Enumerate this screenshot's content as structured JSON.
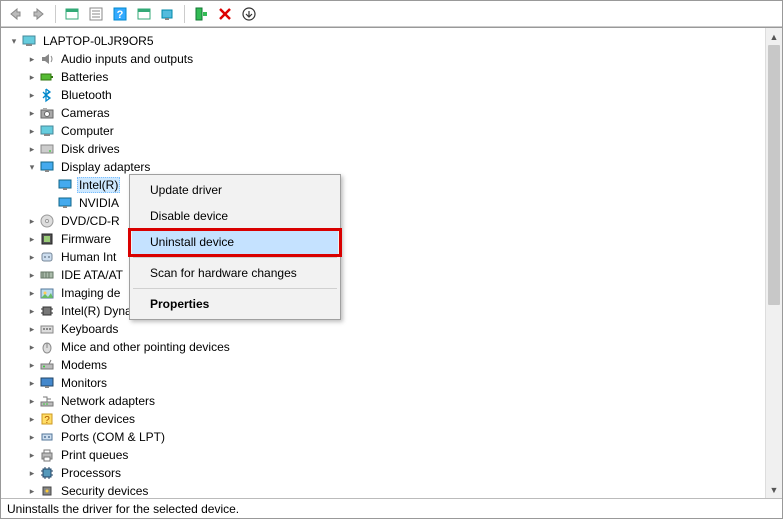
{
  "toolbar": {
    "icons": [
      "back",
      "forward",
      "sep",
      "show-hidden",
      "properties",
      "help",
      "update",
      "monitor",
      "sep",
      "add-legacy",
      "remove",
      "down"
    ]
  },
  "tree": {
    "root": {
      "label": "LAPTOP-0LJR9OR5",
      "expanded": true,
      "icon": "computer"
    },
    "items": [
      {
        "label": "Audio inputs and outputs",
        "icon": "audio",
        "expanded": false
      },
      {
        "label": "Batteries",
        "icon": "battery",
        "expanded": false
      },
      {
        "label": "Bluetooth",
        "icon": "bluetooth",
        "expanded": false
      },
      {
        "label": "Cameras",
        "icon": "camera",
        "expanded": false
      },
      {
        "label": "Computer",
        "icon": "computer",
        "expanded": false
      },
      {
        "label": "Disk drives",
        "icon": "disk",
        "expanded": false
      },
      {
        "label": "Display adapters",
        "icon": "display",
        "expanded": true,
        "children": [
          {
            "label": "Intel(R)",
            "icon": "display",
            "selected": true
          },
          {
            "label": "NVIDIA",
            "icon": "display"
          }
        ]
      },
      {
        "label": "DVD/CD-R",
        "icon": "dvd",
        "expanded": false,
        "truncated": true
      },
      {
        "label": "Firmware",
        "icon": "firmware",
        "expanded": false
      },
      {
        "label": "Human Int",
        "icon": "hid",
        "expanded": false,
        "truncated": true
      },
      {
        "label": "IDE ATA/AT",
        "icon": "ide",
        "expanded": false,
        "truncated": true
      },
      {
        "label": "Imaging de",
        "icon": "imaging",
        "expanded": false,
        "truncated": true
      },
      {
        "label": "Intel(R) Dynamic Platform and Thermal Framework",
        "icon": "chip",
        "expanded": false
      },
      {
        "label": "Keyboards",
        "icon": "keyboard",
        "expanded": false
      },
      {
        "label": "Mice and other pointing devices",
        "icon": "mouse",
        "expanded": false
      },
      {
        "label": "Modems",
        "icon": "modem",
        "expanded": false
      },
      {
        "label": "Monitors",
        "icon": "monitor",
        "expanded": false
      },
      {
        "label": "Network adapters",
        "icon": "network",
        "expanded": false
      },
      {
        "label": "Other devices",
        "icon": "other",
        "expanded": false
      },
      {
        "label": "Ports (COM & LPT)",
        "icon": "port",
        "expanded": false
      },
      {
        "label": "Print queues",
        "icon": "printer",
        "expanded": false
      },
      {
        "label": "Processors",
        "icon": "cpu",
        "expanded": false
      },
      {
        "label": "Security devices",
        "icon": "security",
        "expanded": false,
        "cut": true
      }
    ]
  },
  "context_menu": {
    "items": [
      {
        "label": "Update driver",
        "type": "item"
      },
      {
        "label": "Disable device",
        "type": "item"
      },
      {
        "label": "Uninstall device",
        "type": "item",
        "hover": true,
        "highlighted": true
      },
      {
        "type": "sep"
      },
      {
        "label": "Scan for hardware changes",
        "type": "item"
      },
      {
        "type": "sep"
      },
      {
        "label": "Properties",
        "type": "item",
        "bold": true
      }
    ]
  },
  "statusbar": {
    "text": "Uninstalls the driver for the selected device."
  }
}
